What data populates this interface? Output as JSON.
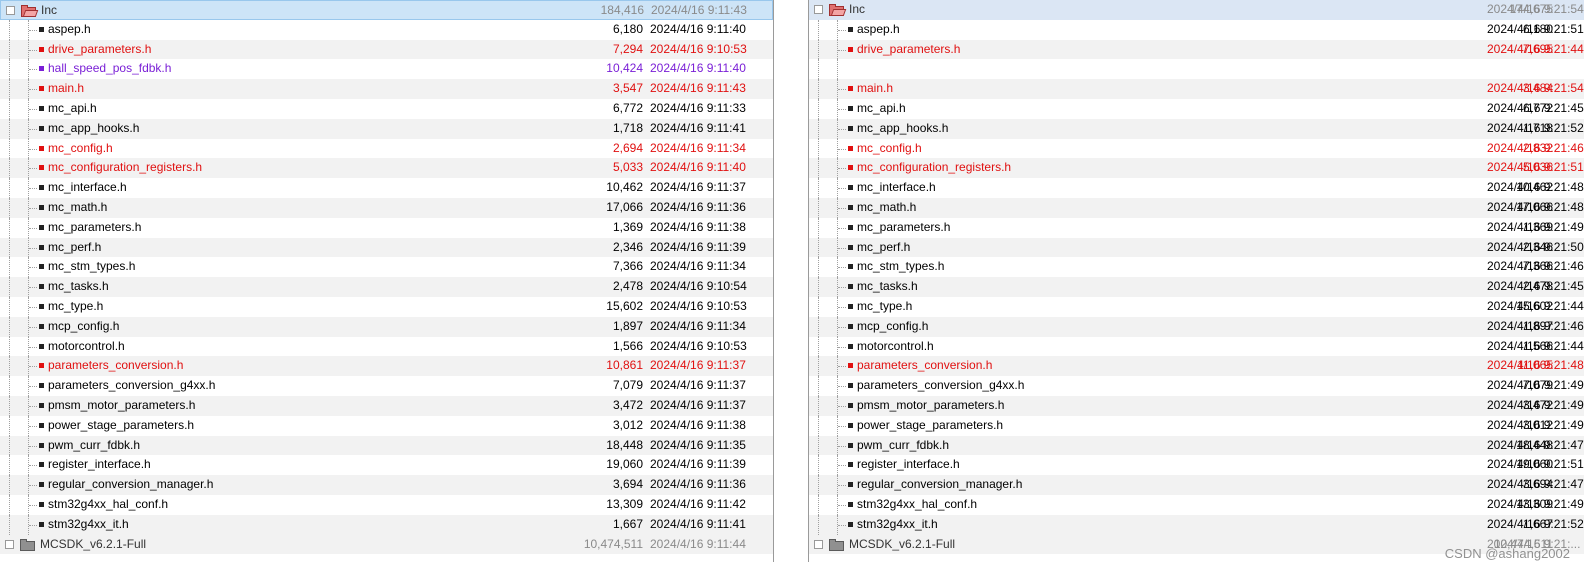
{
  "left": {
    "folder": {
      "name": "Inc",
      "size": "184,416",
      "date": "2024/4/16 9:11:43"
    },
    "files": [
      {
        "name": "aspep.h",
        "size": "6,180",
        "date": "2024/4/16 9:11:40",
        "status": "same"
      },
      {
        "name": "drive_parameters.h",
        "size": "7,294",
        "date": "2024/4/16 9:10:53",
        "status": "diff"
      },
      {
        "name": "hall_speed_pos_fdbk.h",
        "size": "10,424",
        "date": "2024/4/16 9:11:40",
        "status": "orphan"
      },
      {
        "name": "main.h",
        "size": "3,547",
        "date": "2024/4/16 9:11:43",
        "status": "diff"
      },
      {
        "name": "mc_api.h",
        "size": "6,772",
        "date": "2024/4/16 9:11:33",
        "status": "same"
      },
      {
        "name": "mc_app_hooks.h",
        "size": "1,718",
        "date": "2024/4/16 9:11:41",
        "status": "same"
      },
      {
        "name": "mc_config.h",
        "size": "2,694",
        "date": "2024/4/16 9:11:34",
        "status": "diff"
      },
      {
        "name": "mc_configuration_registers.h",
        "size": "5,033",
        "date": "2024/4/16 9:11:40",
        "status": "diff"
      },
      {
        "name": "mc_interface.h",
        "size": "10,462",
        "date": "2024/4/16 9:11:37",
        "status": "same"
      },
      {
        "name": "mc_math.h",
        "size": "17,066",
        "date": "2024/4/16 9:11:36",
        "status": "same"
      },
      {
        "name": "mc_parameters.h",
        "size": "1,369",
        "date": "2024/4/16 9:11:38",
        "status": "same"
      },
      {
        "name": "mc_perf.h",
        "size": "2,346",
        "date": "2024/4/16 9:11:39",
        "status": "same"
      },
      {
        "name": "mc_stm_types.h",
        "size": "7,366",
        "date": "2024/4/16 9:11:34",
        "status": "same"
      },
      {
        "name": "mc_tasks.h",
        "size": "2,478",
        "date": "2024/4/16 9:10:54",
        "status": "same"
      },
      {
        "name": "mc_type.h",
        "size": "15,602",
        "date": "2024/4/16 9:10:53",
        "status": "same"
      },
      {
        "name": "mcp_config.h",
        "size": "1,897",
        "date": "2024/4/16 9:11:34",
        "status": "same"
      },
      {
        "name": "motorcontrol.h",
        "size": "1,566",
        "date": "2024/4/16 9:10:53",
        "status": "same"
      },
      {
        "name": "parameters_conversion.h",
        "size": "10,861",
        "date": "2024/4/16 9:11:37",
        "status": "diff"
      },
      {
        "name": "parameters_conversion_g4xx.h",
        "size": "7,079",
        "date": "2024/4/16 9:11:37",
        "status": "same"
      },
      {
        "name": "pmsm_motor_parameters.h",
        "size": "3,472",
        "date": "2024/4/16 9:11:37",
        "status": "same"
      },
      {
        "name": "power_stage_parameters.h",
        "size": "3,012",
        "date": "2024/4/16 9:11:38",
        "status": "same"
      },
      {
        "name": "pwm_curr_fdbk.h",
        "size": "18,448",
        "date": "2024/4/16 9:11:35",
        "status": "same"
      },
      {
        "name": "register_interface.h",
        "size": "19,060",
        "date": "2024/4/16 9:11:39",
        "status": "same"
      },
      {
        "name": "regular_conversion_manager.h",
        "size": "3,694",
        "date": "2024/4/16 9:11:36",
        "status": "same"
      },
      {
        "name": "stm32g4xx_hal_conf.h",
        "size": "13,309",
        "date": "2024/4/16 9:11:42",
        "status": "same"
      },
      {
        "name": "stm32g4xx_it.h",
        "size": "1,667",
        "date": "2024/4/16 9:11:41",
        "status": "same"
      }
    ],
    "bottom_folder": {
      "name": "MCSDK_v6.2.1-Full",
      "size": "10,474,511",
      "date": "2024/4/16 9:11:44"
    }
  },
  "right": {
    "folder": {
      "name": "Inc",
      "size": "174,675",
      "date": "2024/4/16 9:21:54"
    },
    "files": [
      {
        "name": "aspep.h",
        "size": "6,180",
        "date": "2024/4/16 9:21:51",
        "status": "same"
      },
      {
        "name": "drive_parameters.h",
        "size": "7,695",
        "date": "2024/4/16 9:21:44",
        "status": "diff"
      },
      {
        "name": "",
        "size": "",
        "date": "",
        "status": "empty"
      },
      {
        "name": "main.h",
        "size": "3,484",
        "date": "2024/4/16 9:21:54",
        "status": "diff"
      },
      {
        "name": "mc_api.h",
        "size": "6,772",
        "date": "2024/4/16 9:21:45",
        "status": "same"
      },
      {
        "name": "mc_app_hooks.h",
        "size": "1,718",
        "date": "2024/4/16 9:21:52",
        "status": "same"
      },
      {
        "name": "mc_config.h",
        "size": "2,832",
        "date": "2024/4/16 9:21:46",
        "status": "diff"
      },
      {
        "name": "mc_configuration_registers.h",
        "size": "5,036",
        "date": "2024/4/16 9:21:51",
        "status": "diff"
      },
      {
        "name": "mc_interface.h",
        "size": "10,462",
        "date": "2024/4/16 9:21:48",
        "status": "same"
      },
      {
        "name": "mc_math.h",
        "size": "17,066",
        "date": "2024/4/16 9:21:48",
        "status": "same"
      },
      {
        "name": "mc_parameters.h",
        "size": "1,369",
        "date": "2024/4/16 9:21:49",
        "status": "same"
      },
      {
        "name": "mc_perf.h",
        "size": "2,346",
        "date": "2024/4/16 9:21:50",
        "status": "same"
      },
      {
        "name": "mc_stm_types.h",
        "size": "7,366",
        "date": "2024/4/16 9:21:46",
        "status": "same"
      },
      {
        "name": "mc_tasks.h",
        "size": "2,478",
        "date": "2024/4/16 9:21:45",
        "status": "same"
      },
      {
        "name": "mc_type.h",
        "size": "15,602",
        "date": "2024/4/16 9:21:44",
        "status": "same"
      },
      {
        "name": "mcp_config.h",
        "size": "1,897",
        "date": "2024/4/16 9:21:46",
        "status": "same"
      },
      {
        "name": "motorcontrol.h",
        "size": "1,566",
        "date": "2024/4/16 9:21:44",
        "status": "same"
      },
      {
        "name": "parameters_conversion.h",
        "size": "11,065",
        "date": "2024/4/16 9:21:48",
        "status": "diff"
      },
      {
        "name": "parameters_conversion_g4xx.h",
        "size": "7,079",
        "date": "2024/4/16 9:21:49",
        "status": "same"
      },
      {
        "name": "pmsm_motor_parameters.h",
        "size": "3,472",
        "date": "2024/4/16 9:21:49",
        "status": "same"
      },
      {
        "name": "power_stage_parameters.h",
        "size": "3,012",
        "date": "2024/4/16 9:21:49",
        "status": "same"
      },
      {
        "name": "pwm_curr_fdbk.h",
        "size": "18,448",
        "date": "2024/4/16 9:21:47",
        "status": "same"
      },
      {
        "name": "register_interface.h",
        "size": "19,060",
        "date": "2024/4/16 9:21:51",
        "status": "same"
      },
      {
        "name": "regular_conversion_manager.h",
        "size": "3,694",
        "date": "2024/4/16 9:21:47",
        "status": "same"
      },
      {
        "name": "stm32g4xx_hal_conf.h",
        "size": "13,309",
        "date": "2024/4/16 9:21:49",
        "status": "same"
      },
      {
        "name": "stm32g4xx_it.h",
        "size": "1,667",
        "date": "2024/4/16 9:21:52",
        "status": "same"
      }
    ],
    "bottom_folder": {
      "name": "MCSDK_v6.2.1-Full",
      "size": "10,474,511",
      "date": "2024/4/16 9:21:..."
    }
  },
  "watermark": "CSDN @ashang2002",
  "colors": {
    "diff": "#e01010",
    "orphan": "#7a1fd6",
    "same": "#000000",
    "selected_bg": "#cde4f7"
  }
}
